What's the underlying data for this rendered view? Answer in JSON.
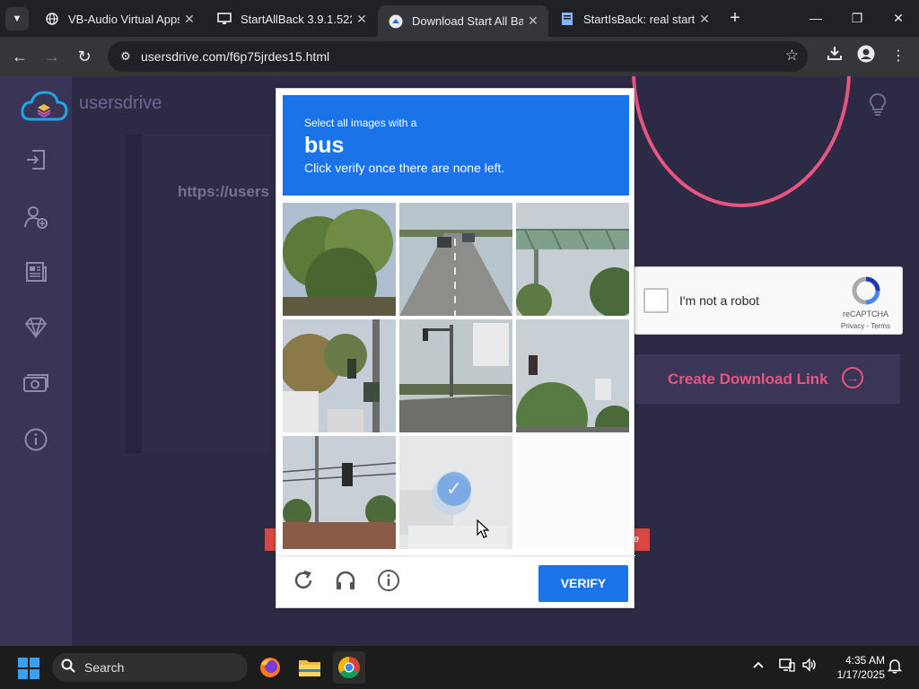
{
  "browser": {
    "tabs": [
      {
        "title": "VB-Audio Virtual Apps",
        "icon": "globe-icon"
      },
      {
        "title": "StartAllBack 3.9.1.5222",
        "icon": "monitor-icon"
      },
      {
        "title": "Download Start All Back",
        "icon": "usersdrive-favicon-icon"
      },
      {
        "title": "StartIsBack: real start m",
        "icon": "document-icon"
      }
    ],
    "url": "usersdrive.com/f6p75jrdes15.html"
  },
  "page": {
    "brand": "usersdrive",
    "link_text": "https://users",
    "create_link": "Create Download Link"
  },
  "recaptcha_widget": {
    "label": "I'm not a robot",
    "brand": "reCAPTCHA",
    "links": "Privacy - Terms"
  },
  "challenge": {
    "line1": "Select all images with a",
    "target": "bus",
    "line3": "Click verify once there are none left.",
    "verify_label": "VERIFY"
  },
  "taskbar": {
    "search_label": "Search",
    "time": "4:35 AM",
    "date": "1/17/2025"
  }
}
